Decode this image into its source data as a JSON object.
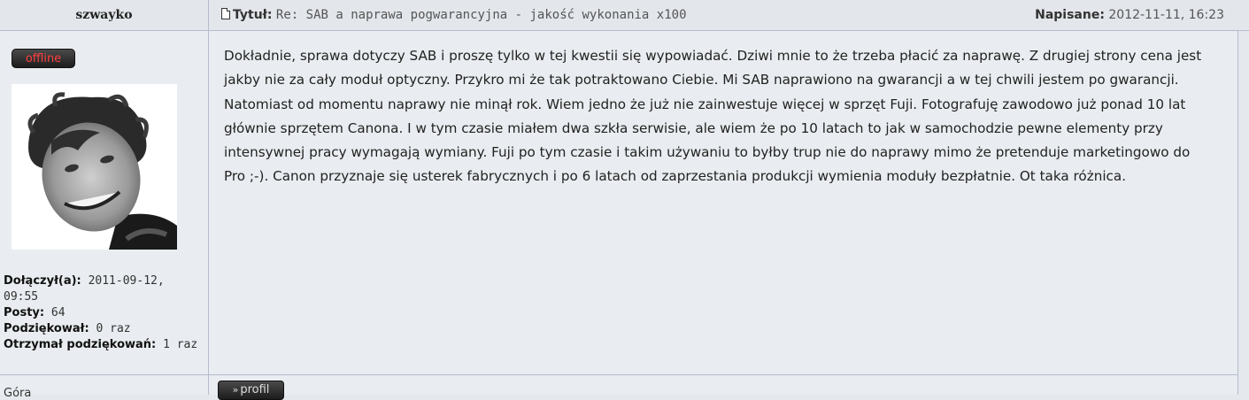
{
  "post": {
    "author": "szwayko",
    "title_label": "Tytuł:",
    "title": "Re: SAB a naprawa pogwarancyjna - jakość wykonania x100",
    "date_label": "Napisane:",
    "date": "2012-11-11, 16:23",
    "body": "Dokładnie, sprawa dotyczy SAB i proszę tylko w tej kwestii się wypowiadać. Dziwi mnie to że trzeba płacić za naprawę. Z drugiej strony cena jest jakby nie za cały moduł optyczny. Przykro mi że tak potraktowano Ciebie. Mi SAB naprawiono na gwarancji a w tej chwili jestem po gwarancji. Natomiast od momentu naprawy nie minął rok. Wiem jedno że już nie zainwestuje więcej w sprzęt Fuji. Fotografuję zawodowo już ponad 10 lat głównie sprzętem Canona. I w tym czasie miałem dwa szkła serwisie, ale wiem że po 10 latach to jak w samochodzie pewne elementy przy intensywnej pracy wymagają wymiany. Fuji po tym czasie i takim używaniu to byłby trup nie do naprawy mimo że pretenduje marketingowo do Pro ;-). Canon przyznaje się usterek fabrycznych i po 6 latach od zaprzestania produkcji wymienia moduły bezpłatnie. Ot taka różnica."
  },
  "profile": {
    "status": "offline",
    "joined_label": "Dołączył(a):",
    "joined": "2011-09-12, 09:55",
    "posts_label": "Posty:",
    "posts": "64",
    "thanked_label": "Podziękował:",
    "thanked": "0 raz",
    "received_label": "Otrzymał podziękowań:",
    "received": "1 raz"
  },
  "footer": {
    "top_link": "Góra",
    "profile_button": "profil"
  },
  "colors": {
    "background": "#e9ecf0",
    "border": "#b4bccb",
    "badge_offline_text": "#ff4040"
  }
}
